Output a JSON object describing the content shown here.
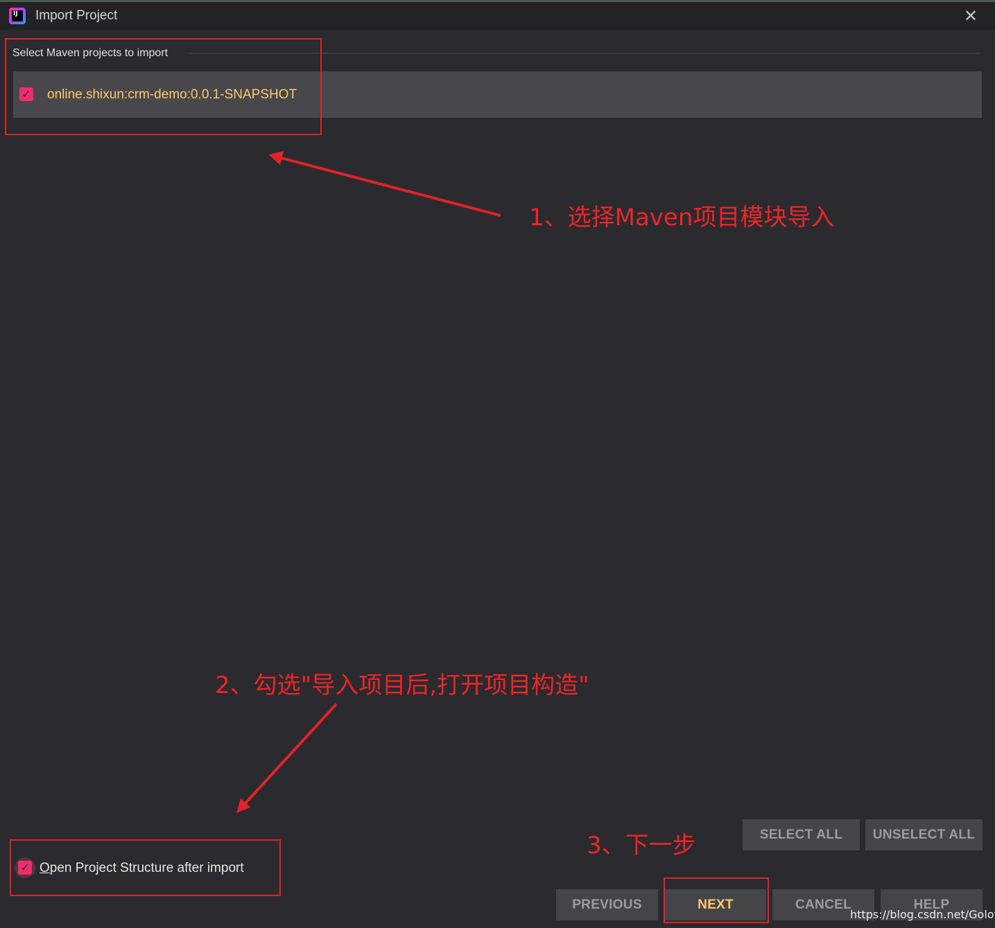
{
  "window": {
    "title": "Import Project",
    "close_glyph": "✕",
    "app_icon_label": "IJ"
  },
  "section": {
    "label": "Select Maven projects to import"
  },
  "projects": [
    {
      "label": "online.shixun:crm-demo:0.0.1-SNAPSHOT",
      "checked": true
    }
  ],
  "options": {
    "open_structure_mnemonic": "O",
    "open_structure_rest": "pen Project Structure after import",
    "open_structure_checked": true
  },
  "buttons": {
    "select_all": "SELECT ALL",
    "unselect_all": "UNSELECT ALL",
    "previous": "PREVIOUS",
    "next": "NEXT",
    "cancel": "CANCEL",
    "help": "HELP"
  },
  "annotations": {
    "step1": "1、选择Maven项目模块导入",
    "step2": "2、勾选\"导入项目后,打开项目构造\"",
    "step3": "3、下一步"
  },
  "watermark": "https://blog.csdn.net/Golovin",
  "colors": {
    "background": "#2b2a2e",
    "accent_pink": "#f02d6c",
    "project_text": "#ffcb6b",
    "annotation_red": "#ea2629"
  }
}
